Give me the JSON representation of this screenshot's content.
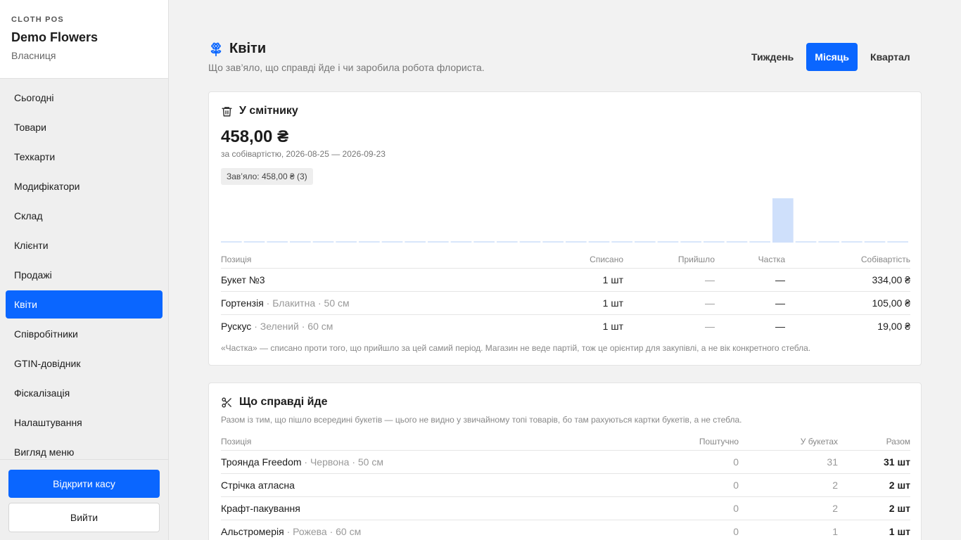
{
  "brand": {
    "label": "CLOTH POS",
    "store": "Demo Flowers",
    "role": "Власниця"
  },
  "nav": [
    {
      "label": "Сьогодні",
      "active": false
    },
    {
      "label": "Товари",
      "active": false
    },
    {
      "label": "Техкарти",
      "active": false
    },
    {
      "label": "Модифікатори",
      "active": false
    },
    {
      "label": "Склад",
      "active": false
    },
    {
      "label": "Клієнти",
      "active": false
    },
    {
      "label": "Продажі",
      "active": false
    },
    {
      "label": "Квіти",
      "active": true
    },
    {
      "label": "Співробітники",
      "active": false
    },
    {
      "label": "GTIN-довідник",
      "active": false
    },
    {
      "label": "Фіскалізація",
      "active": false
    },
    {
      "label": "Налаштування",
      "active": false
    },
    {
      "label": "Вигляд меню",
      "active": false
    }
  ],
  "footer": {
    "open_register": "Відкрити касу",
    "logout": "Вийти"
  },
  "header": {
    "icon": "flower-icon",
    "title": "Квіти",
    "subtitle": "Що зав’яло, що справді йде і чи заробила робота флориста."
  },
  "periods": [
    {
      "label": "Тиждень",
      "active": false
    },
    {
      "label": "Місяць",
      "active": true
    },
    {
      "label": "Квартал",
      "active": false
    }
  ],
  "trash": {
    "icon": "trash-icon",
    "title": "У смітнику",
    "amount": "458,00 ₴",
    "amount_sub": "за собівартістю, 2026-08-25 — 2026-09-23",
    "pill": "Зав’яло: 458,00 ₴ (3)",
    "daily_writeoffs": [
      0,
      0,
      0,
      0,
      0,
      0,
      0,
      0,
      0,
      0,
      0,
      0,
      0,
      0,
      0,
      0,
      0,
      0,
      0,
      0,
      0,
      0,
      0,
      0,
      458,
      0,
      0,
      0,
      0,
      0
    ],
    "columns": [
      "Позиція",
      "Списано",
      "Прийшло",
      "Частка",
      "Собівартість"
    ],
    "rows": [
      {
        "name": "Букет №3",
        "variant": "",
        "written_off": "1 шт",
        "arrived": "—",
        "share": "—",
        "cost": "334,00 ₴"
      },
      {
        "name": "Гортензія",
        "variant": " · Блакитна · 50 см",
        "written_off": "1 шт",
        "arrived": "—",
        "share": "—",
        "cost": "105,00 ₴"
      },
      {
        "name": "Рускус",
        "variant": " · Зелений · 60 см",
        "written_off": "1 шт",
        "arrived": "—",
        "share": "—",
        "cost": "19,00 ₴"
      }
    ],
    "note": "«Частка» — списано проти того, що прийшло за цей самий період. Магазин не веде партій, тож це орієнтир для закупівлі, а не вік конкретного стебла."
  },
  "usage": {
    "icon": "scissors-icon",
    "title": "Що справді йде",
    "subtitle": "Разом із тим, що пішло всередині букетів — цього не видно у звичайному топі товарів, бо там рахуються картки букетів, а не стебла.",
    "columns": [
      "Позиція",
      "Поштучно",
      "У букетах",
      "Разом"
    ],
    "rows": [
      {
        "name": "Троянда Freedom",
        "variant": " · Червона · 50 см",
        "single": "0",
        "in_bouquets": "31",
        "total": "31 шт"
      },
      {
        "name": "Стрічка атласна",
        "variant": "",
        "single": "0",
        "in_bouquets": "2",
        "total": "2 шт"
      },
      {
        "name": "Крафт-пакування",
        "variant": "",
        "single": "0",
        "in_bouquets": "2",
        "total": "2 шт"
      },
      {
        "name": "Альстромерія",
        "variant": " · Рожева · 60 см",
        "single": "0",
        "in_bouquets": "1",
        "total": "1 шт"
      }
    ]
  },
  "colors": {
    "accent": "#0a66ff",
    "bar": "#cfe0fb",
    "bar_baseline": "#d8e6fb"
  }
}
